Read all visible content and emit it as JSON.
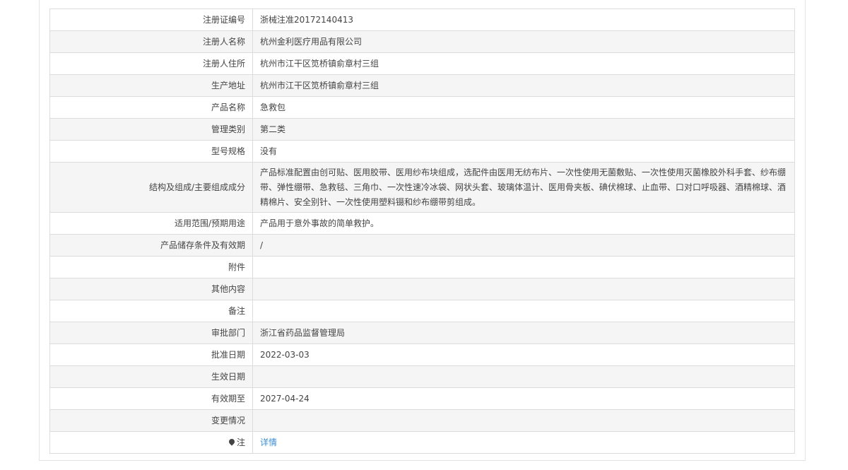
{
  "rows": [
    {
      "label": "注册证编号",
      "value": "浙械注准20172140413"
    },
    {
      "label": "注册人名称",
      "value": "杭州金利医疗用品有限公司"
    },
    {
      "label": "注册人住所",
      "value": "杭州市江干区笕桥镇俞章村三组"
    },
    {
      "label": "生产地址",
      "value": "杭州市江干区笕桥镇俞章村三组"
    },
    {
      "label": "产品名称",
      "value": "急救包"
    },
    {
      "label": "管理类别",
      "value": "第二类"
    },
    {
      "label": "型号规格",
      "value": "没有"
    },
    {
      "label": "结构及组成/主要组成成分",
      "value": "产品标准配置由创可贴、医用胶带、医用纱布块组成，选配件由医用无纺布片、一次性使用无菌敷贴、一次性使用灭菌橡胶外科手套、纱布绷带、弹性绷带、急救毯、三角巾、一次性速冷冰袋、网状头套、玻璃体温计、医用骨夹板、碘伏棉球、止血带、口对口呼吸器、酒精棉球、酒精棉片、安全别针、一次性使用塑料镊和纱布绷带剪组成。"
    },
    {
      "label": "适用范围/预期用途",
      "value": "产品用于意外事故的简单救护。"
    },
    {
      "label": "产品储存条件及有效期",
      "value": "/"
    },
    {
      "label": "附件",
      "value": ""
    },
    {
      "label": "其他内容",
      "value": ""
    },
    {
      "label": "备注",
      "value": ""
    },
    {
      "label": "审批部门",
      "value": "浙江省药品监督管理局"
    },
    {
      "label": "批准日期",
      "value": "2022-03-03"
    },
    {
      "label": "生效日期",
      "value": ""
    },
    {
      "label": "有效期至",
      "value": "2027-04-24"
    },
    {
      "label": "变更情况",
      "value": ""
    }
  ],
  "note": {
    "label": "注",
    "link": "详情"
  }
}
